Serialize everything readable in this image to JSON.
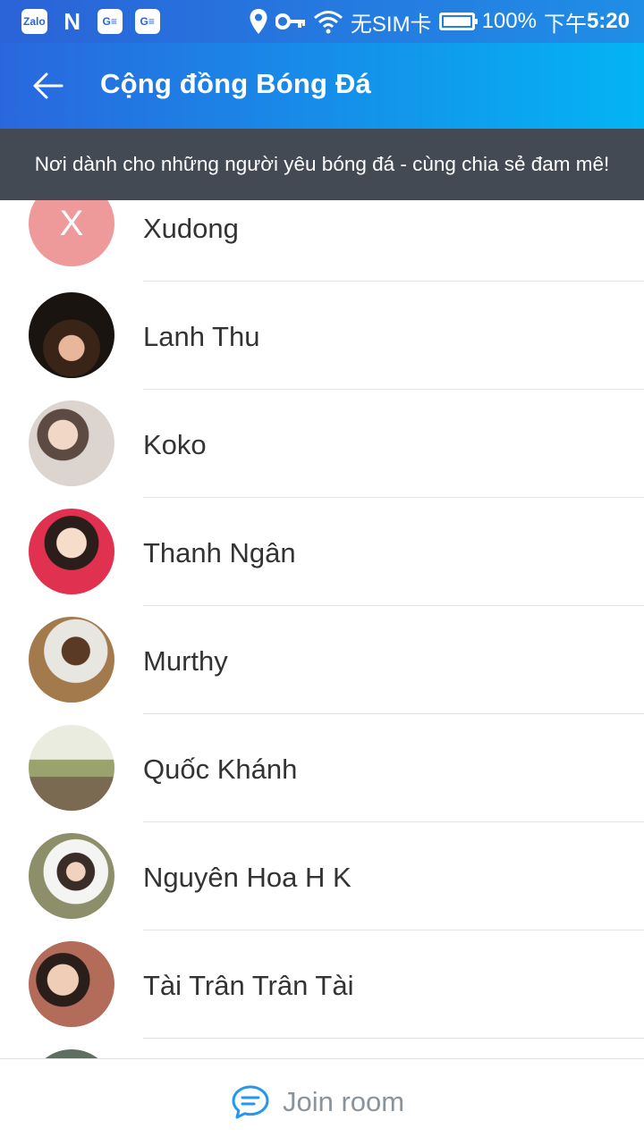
{
  "status_bar": {
    "app_badges": [
      "Zalo",
      "N",
      "G≡",
      "G≡"
    ],
    "sim": "无SIM卡",
    "battery": "100%",
    "time_prefix": "下午",
    "time": "5:20",
    "icons": [
      "location-icon",
      "key-icon",
      "wifi-icon",
      "battery-icon"
    ]
  },
  "header": {
    "title": "Cộng đồng Bóng Đá",
    "back_icon": "arrow-left-icon",
    "colors": {
      "start": "#2a67de",
      "end": "#03b4f4"
    }
  },
  "banner": {
    "text": "Nơi dành cho những người yêu bóng đá - cùng chia sẻ đam mê!",
    "color": "#434a54"
  },
  "members": [
    {
      "name": "Xudong",
      "initial": "X",
      "avatar_color": "#ef9a9a"
    },
    {
      "name": "Lanh Thu",
      "avatar_color": "#5b3a2e"
    },
    {
      "name": "Koko",
      "avatar_color": "#c9b7a8"
    },
    {
      "name": "Thanh Ngân",
      "avatar_color": "#d6334a"
    },
    {
      "name": "Murthy",
      "avatar_color": "#8c6a45"
    },
    {
      "name": "Quốc Khánh",
      "avatar_color": "#9a9270"
    },
    {
      "name": "Nguyên Hoa H K",
      "avatar_color": "#6f7f5d"
    },
    {
      "name": "Tài Trân Trân Tài",
      "avatar_color": "#a06a5a"
    },
    {
      "name": "",
      "avatar_color": "#6d8070"
    }
  ],
  "footer": {
    "join_label": "Join room",
    "join_icon": "chat-bubble-icon",
    "accent": "#2196f3"
  }
}
